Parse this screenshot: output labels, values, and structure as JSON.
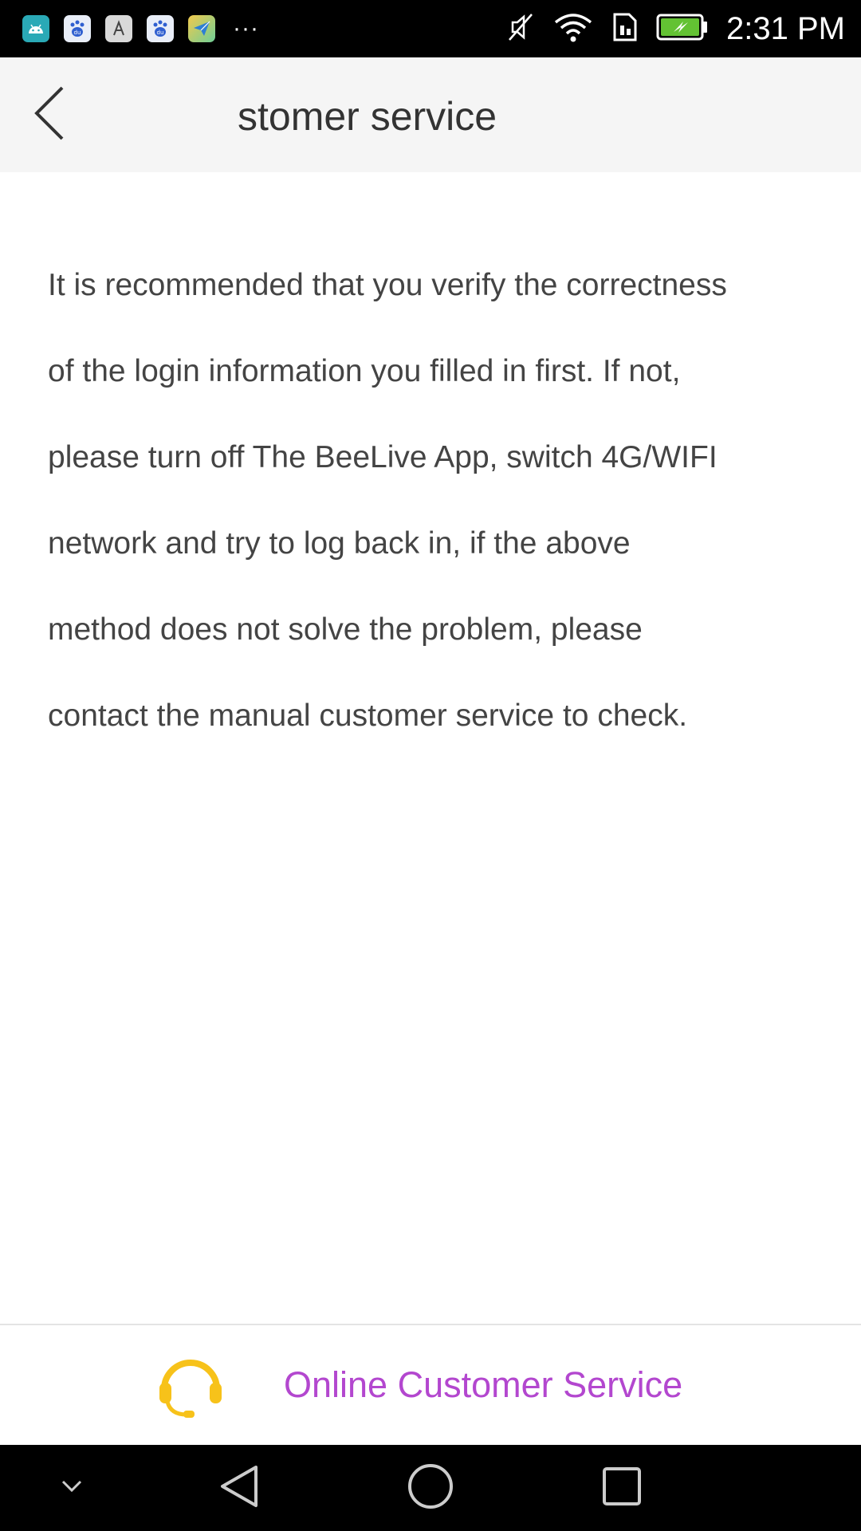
{
  "status_bar": {
    "time": "2:31 PM",
    "more_indicator": "···",
    "notification_icons": [
      "android-app-icon",
      "baidu-icon",
      "font-app-icon",
      "baidu-icon",
      "paper-plane-app-icon"
    ],
    "system_icons": [
      "mute-icon",
      "wifi-icon",
      "sim-icon",
      "battery-charging-icon"
    ]
  },
  "header": {
    "title": "stomer service",
    "back_icon": "chevron-left-icon"
  },
  "content": {
    "lines": [
      "It is recommended that you verify the correctness",
      "of the login information you filled in first. If not,",
      "please turn off The BeeLive App, switch 4G/WIFI",
      "network and try to log back in, if the above",
      "method does not solve the problem, please",
      "contact the manual customer service to check."
    ]
  },
  "service_bar": {
    "label": "Online Customer Service",
    "icon": "headset-icon",
    "label_color": "#b347cf",
    "icon_color": "#f7c21a"
  },
  "nav_bar": {
    "icons": [
      "chevron-down-icon",
      "back-triangle-icon",
      "home-circle-icon",
      "recents-square-icon"
    ]
  }
}
